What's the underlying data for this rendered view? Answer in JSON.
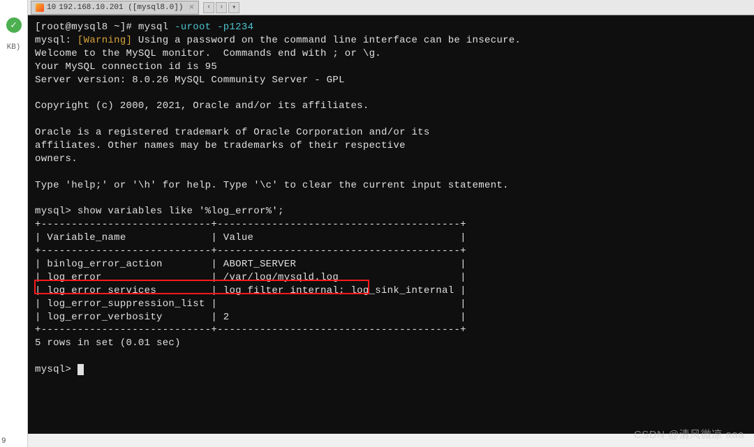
{
  "left_panel": {
    "kb_label": "KB)"
  },
  "corner_num": "9",
  "tab": {
    "bullet_label": "10",
    "title": "192.168.10.201 ([mysql8.0])",
    "close_glyph": "×"
  },
  "nav": {
    "left": "‹",
    "right": "›",
    "dropdown": "▾"
  },
  "terminal": {
    "prompt_prefix": "[root@mysql8 ~]# ",
    "cmd": "mysql ",
    "opt1": "-uroot ",
    "opt2": "-p1234",
    "line_mysql_prefix": "mysql: ",
    "warning_tag": "[Warning]",
    "warning_rest": " Using a password on the command line interface can be insecure.",
    "welcome1": "Welcome to the MySQL monitor.  Commands end with ; or \\g.",
    "welcome2": "Your MySQL connection id is 95",
    "welcome3": "Server version: 8.0.26 MySQL Community Server - GPL",
    "copyright": "Copyright (c) 2000, 2021, Oracle and/or its affiliates.",
    "trademark1": "Oracle is a registered trademark of Oracle Corporation and/or its",
    "trademark2": "affiliates. Other names may be trademarks of their respective",
    "trademark3": "owners.",
    "help_line": "Type 'help;' or '\\h' for help. Type '\\c' to clear the current input statement.",
    "prompt2": "mysql> ",
    "query": "show variables like '%log_error%';",
    "table_sep": "+----------------------------+----------------------------------------+",
    "table_head": "| Variable_name              | Value                                  |",
    "row1": "| binlog_error_action        | ABORT_SERVER                           |",
    "row2": "| log_error                  | /var/log/mysqld.log                    |",
    "row3": "| log_error_services         | log_filter_internal; log_sink_internal |",
    "row4": "| log_error_suppression_list |                                        |",
    "row5": "| log_error_verbosity        | 2                                      |",
    "rows_msg": "5 rows in set (0.01 sec)",
    "prompt3": "mysql> "
  },
  "watermark": "CSDN @清风微凉 aaa",
  "table_data": {
    "columns": [
      "Variable_name",
      "Value"
    ],
    "rows": [
      {
        "Variable_name": "binlog_error_action",
        "Value": "ABORT_SERVER"
      },
      {
        "Variable_name": "log_error",
        "Value": "/var/log/mysqld.log"
      },
      {
        "Variable_name": "log_error_services",
        "Value": "log_filter_internal; log_sink_internal"
      },
      {
        "Variable_name": "log_error_suppression_list",
        "Value": ""
      },
      {
        "Variable_name": "log_error_verbosity",
        "Value": "2"
      }
    ]
  }
}
